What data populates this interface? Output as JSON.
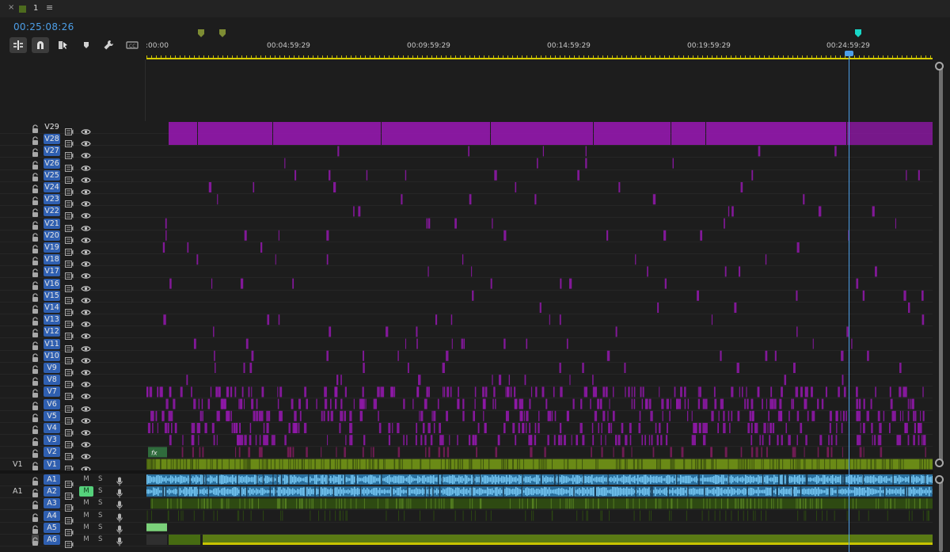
{
  "panel": {
    "close_glyph": "×",
    "sequence_name": "1",
    "menu_glyph": "≡",
    "timecode": "00:25:08:26"
  },
  "toolbar": {
    "tools": [
      "insert-snap-icon",
      "magnet-icon",
      "linked-selection-icon",
      "marker-icon",
      "wrench-icon",
      "captions-icon"
    ]
  },
  "ruler": {
    "labels": [
      ":00:00",
      "00:04:59:29",
      "00:09:59:29",
      "00:14:59:29",
      "00:19:59:29",
      "00:24:59:29"
    ]
  },
  "video_tracks": [
    "V29",
    "V28",
    "V27",
    "V26",
    "V25",
    "V24",
    "V23",
    "V22",
    "V21",
    "V20",
    "V19",
    "V18",
    "V17",
    "V16",
    "V15",
    "V14",
    "V13",
    "V12",
    "V11",
    "V10",
    "V9",
    "V8",
    "V7",
    "V6",
    "V5",
    "V4",
    "V3",
    "V2",
    "V1"
  ],
  "video_selected": [
    "V28",
    "V27",
    "V26",
    "V25",
    "V24",
    "V23",
    "V22",
    "V21",
    "V20",
    "V19",
    "V18",
    "V17",
    "V16",
    "V15",
    "V14",
    "V13",
    "V12",
    "V11",
    "V10",
    "V9",
    "V8",
    "V7",
    "V6",
    "V5",
    "V4",
    "V3",
    "V2",
    "V1"
  ],
  "video_source_label": "V1",
  "audio_tracks": [
    {
      "name": "A1",
      "mute": "M",
      "solo": "S",
      "mute_on": false
    },
    {
      "name": "A2",
      "mute": "M",
      "solo": "S",
      "mute_on": true
    },
    {
      "name": "A3",
      "mute": "M",
      "solo": "S",
      "mute_on": false
    },
    {
      "name": "A4",
      "mute": "M",
      "solo": "S",
      "mute_on": false
    },
    {
      "name": "A5",
      "mute": "M",
      "solo": "S",
      "mute_on": false
    },
    {
      "name": "A6",
      "mute": "M",
      "solo": "S",
      "mute_on": false
    }
  ],
  "audio_source_label": "A1",
  "effects_badge": "fx",
  "colors": {
    "accent": "#4d9fe8",
    "clip_purple": "#8e18a6",
    "clip_green": "#5a7a14",
    "audio_blue": "#2f7fb9",
    "track_selected": "#2f5fb0"
  }
}
